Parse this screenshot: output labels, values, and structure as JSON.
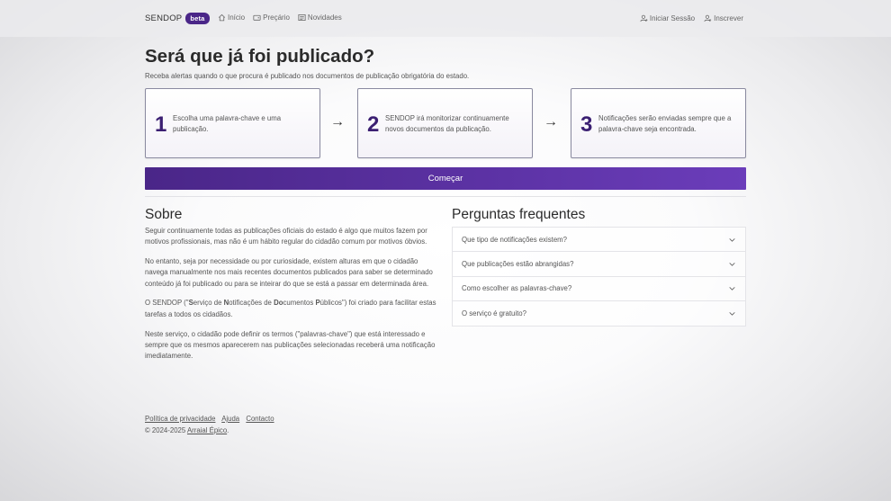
{
  "navbar": {
    "brand": "SENDOP",
    "badge": "beta",
    "links": [
      {
        "label": "Início",
        "icon": "home-icon"
      },
      {
        "label": "Preçário",
        "icon": "wallet-icon"
      },
      {
        "label": "Novidades",
        "icon": "news-icon"
      }
    ],
    "right_links": [
      {
        "label": "Iniciar Sessão",
        "icon": "user-login-icon"
      },
      {
        "label": "Inscrever",
        "icon": "user-add-icon"
      }
    ]
  },
  "hero": {
    "title": "Será que já foi publicado?",
    "subtitle": "Receba alertas quando o que procura é publicado nos documentos de publicação obrigatória do estado."
  },
  "steps": [
    {
      "number": "1",
      "text": "Escolha uma palavra-chave e uma publicação."
    },
    {
      "number": "2",
      "text": "SENDOP irá monitorizar continuamente novos documentos da publicação."
    },
    {
      "number": "3",
      "text": "Notificações serão enviadas sempre que a palavra-chave seja encontrada."
    }
  ],
  "arrow": "→",
  "start_button": "Começar",
  "about": {
    "title": "Sobre",
    "p1": "Seguir continuamente todas as publicações oficiais do estado é algo que muitos fazem por motivos profissionais, mas não é um hábito regular do cidadão comum por motivos óbvios.",
    "p2": "No entanto, seja por necessidade ou por curiosidade, existem alturas em que o cidadão navega manualmente nos mais recentes documentos publicados para saber se determinado conteúdo já foi publicado ou para se inteirar do que se está a passar em determinada área.",
    "p3": {
      "prefix": "O SENDOP (\"",
      "s": "S",
      "s_rest": "erviço de ",
      "n": "N",
      "n_rest": "otificações de ",
      "do": "Do",
      "do_rest": "cumentos ",
      "p": "P",
      "p_rest": "úblicos\") foi criado para facilitar estas tarefas a todos os cidadãos."
    },
    "p4": "Neste serviço, o cidadão pode definir os termos (\"palavras-chave\") que está interessado e sempre que os mesmos aparecerem nas publicações selecionadas receberá uma notificação imediatamente."
  },
  "faq": {
    "title": "Perguntas frequentes",
    "items": [
      "Que tipo de notificações existem?",
      "Que publicações estão abrangidas?",
      "Como escolher as palavras-chave?",
      "O serviço é gratuito?"
    ]
  },
  "footer": {
    "links": [
      "Política de privacidade",
      "Ajuda",
      "Contacto"
    ],
    "copyright": "© 2024-2025",
    "author": "Arraial Épico",
    "suffix": "."
  },
  "colors": {
    "accent": "#4a2688",
    "step_number": "#3b1f72"
  }
}
